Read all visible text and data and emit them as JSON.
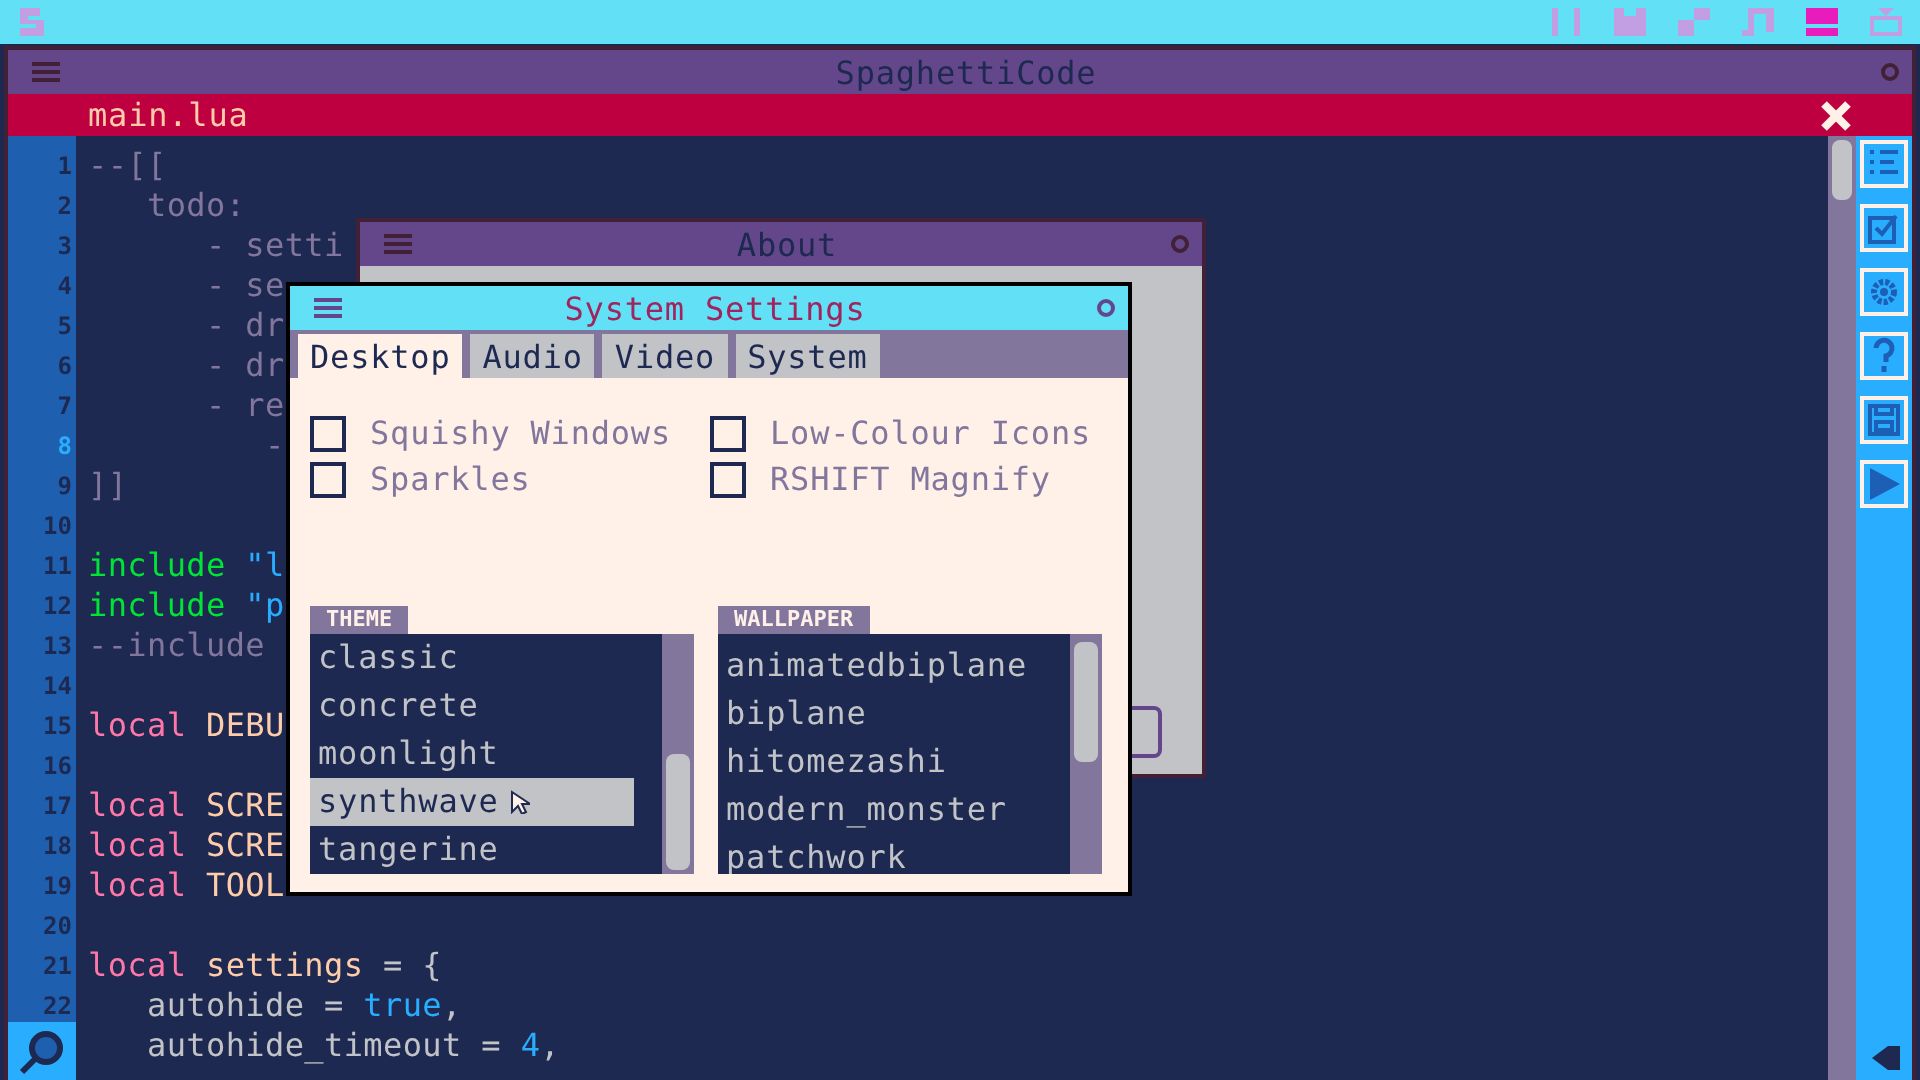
{
  "top_bar": {
    "workspaces": [
      {
        "kind": "code",
        "selected": false
      },
      {
        "kind": "sprite",
        "selected": false
      },
      {
        "kind": "map",
        "selected": false
      },
      {
        "kind": "music",
        "selected": false
      },
      {
        "kind": "desktop",
        "selected": true
      },
      {
        "kind": "tv",
        "selected": false
      }
    ]
  },
  "editor": {
    "title": "SpaghettiCode",
    "tab": "main.lua",
    "lines": [
      {
        "number": "1",
        "current": false,
        "tokens": [
          {
            "kind": "comment",
            "text": "--[["
          }
        ]
      },
      {
        "number": "2",
        "current": false,
        "tokens": [
          {
            "kind": "comment",
            "text": "   todo:"
          }
        ]
      },
      {
        "number": "3",
        "current": false,
        "tokens": [
          {
            "kind": "comment",
            "text": "      - setti"
          }
        ]
      },
      {
        "number": "4",
        "current": false,
        "tokens": [
          {
            "kind": "comment",
            "text": "      - se"
          }
        ]
      },
      {
        "number": "5",
        "current": false,
        "tokens": [
          {
            "kind": "comment",
            "text": "      - dr"
          }
        ]
      },
      {
        "number": "6",
        "current": false,
        "tokens": [
          {
            "kind": "comment",
            "text": "      - dr"
          }
        ]
      },
      {
        "number": "7",
        "current": false,
        "tokens": [
          {
            "kind": "comment",
            "text": "      - re"
          }
        ]
      },
      {
        "number": "8",
        "current": true,
        "tokens": [
          {
            "kind": "comment",
            "text": "         -"
          }
        ]
      },
      {
        "number": "9",
        "current": false,
        "tokens": [
          {
            "kind": "comment",
            "text": "]]"
          }
        ]
      },
      {
        "number": "10",
        "current": false
      },
      {
        "number": "11",
        "current": false,
        "tokens": [
          {
            "kind": "builtin",
            "text": "include "
          },
          {
            "kind": "string",
            "text": "\"l"
          }
        ]
      },
      {
        "number": "12",
        "current": false,
        "tokens": [
          {
            "kind": "builtin",
            "text": "include "
          },
          {
            "kind": "string",
            "text": "\"p"
          }
        ]
      },
      {
        "number": "13",
        "current": false,
        "tokens": [
          {
            "kind": "comment",
            "text": "--include"
          }
        ]
      },
      {
        "number": "14",
        "current": false
      },
      {
        "number": "15",
        "current": false,
        "tokens": [
          {
            "kind": "keyword",
            "text": "local "
          },
          {
            "kind": "name",
            "text": "DEBU"
          }
        ]
      },
      {
        "number": "16",
        "current": false
      },
      {
        "number": "17",
        "current": false,
        "tokens": [
          {
            "kind": "keyword",
            "text": "local "
          },
          {
            "kind": "name",
            "text": "SCRE"
          }
        ]
      },
      {
        "number": "18",
        "current": false,
        "tokens": [
          {
            "kind": "keyword",
            "text": "local "
          },
          {
            "kind": "name",
            "text": "SCRE"
          }
        ]
      },
      {
        "number": "19",
        "current": false,
        "tokens": [
          {
            "kind": "keyword",
            "text": "local "
          },
          {
            "kind": "name",
            "text": "TOOL"
          }
        ]
      },
      {
        "number": "20",
        "current": false
      },
      {
        "number": "21",
        "current": false,
        "tokens": [
          {
            "kind": "keyword",
            "text": "local "
          },
          {
            "kind": "name",
            "text": "settings"
          },
          {
            "kind": "plain",
            "text": " = {"
          }
        ]
      },
      {
        "number": "22",
        "current": false,
        "tokens": [
          {
            "kind": "plain",
            "text": "   autohide = "
          },
          {
            "kind": "number",
            "text": "true"
          },
          {
            "kind": "plain",
            "text": ","
          }
        ]
      },
      {
        "tokens": [
          {
            "kind": "plain",
            "text": "   autohide_timeout = "
          },
          {
            "kind": "number",
            "text": "4"
          },
          {
            "kind": "plain",
            "text": ","
          }
        ]
      }
    ]
  },
  "about": {
    "title": "About"
  },
  "settings": {
    "title": "System Settings",
    "tabs": [
      {
        "label": "Desktop",
        "selected": true
      },
      {
        "label": "Audio",
        "selected": false
      },
      {
        "label": "Video",
        "selected": false
      },
      {
        "label": "System",
        "selected": false
      }
    ],
    "options": [
      {
        "label": "Squishy Windows",
        "checked": false
      },
      {
        "label": "Low-Colour Icons",
        "checked": false
      },
      {
        "label": "Sparkles",
        "checked": false
      },
      {
        "label": "RSHIFT Magnify",
        "checked": false
      }
    ],
    "theme": {
      "label": "THEME",
      "items": [
        {
          "label": "classic",
          "selected": false
        },
        {
          "label": "concrete",
          "selected": false
        },
        {
          "label": "moonlight",
          "selected": false
        },
        {
          "label": "synthwave",
          "selected": true
        },
        {
          "label": "tangerine",
          "selected": false
        }
      ]
    },
    "wallpaper": {
      "label": "WALLPAPER",
      "items": [
        {
          "label": "animatedbiplane",
          "selected": false
        },
        {
          "label": "biplane",
          "selected": false
        },
        {
          "label": "hitomezashi",
          "selected": false
        },
        {
          "label": "modern_monster",
          "selected": false
        },
        {
          "label": "patchwork",
          "selected": false
        }
      ]
    }
  }
}
